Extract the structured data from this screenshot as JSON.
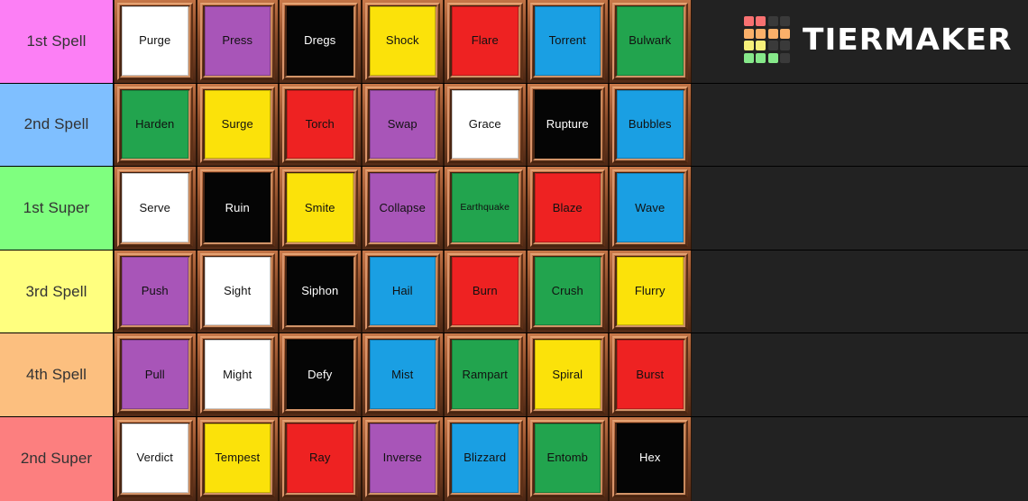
{
  "app": {
    "name": "TierMaker",
    "background_color": "#222222",
    "frame_color": "#a7613a"
  },
  "logo": {
    "wordmark": "TIERMAKER",
    "grid_colors": [
      [
        "#f87171",
        "#f87171",
        "#3a3a3a",
        "#3a3a3a"
      ],
      [
        "#fbb069",
        "#fbb069",
        "#fbb069",
        "#fbb069"
      ],
      [
        "#f7f07a",
        "#f7f07a",
        "#3a3a3a",
        "#3a3a3a"
      ],
      [
        "#86e88a",
        "#86e88a",
        "#86e88a",
        "#3a3a3a"
      ]
    ]
  },
  "palette": {
    "white": "#ffffff",
    "purple": "#a855b8",
    "black": "#050505",
    "yellow": "#fbe20a",
    "red": "#ee2222",
    "blue": "#1a9fe3",
    "green": "#22a martial"
  },
  "tiers": [
    {
      "label": "1st Spell",
      "color": "#fc7ff5",
      "cards": [
        {
          "label": "Purge",
          "bg": "#ffffff",
          "fg": "#111111"
        },
        {
          "label": "Press",
          "bg": "#a855b8",
          "fg": "#111111"
        },
        {
          "label": "Dregs",
          "bg": "#050505",
          "fg": "#ffffff"
        },
        {
          "label": "Shock",
          "bg": "#fbe20a",
          "fg": "#111111"
        },
        {
          "label": "Flare",
          "bg": "#ee2222",
          "fg": "#111111"
        },
        {
          "label": "Torrent",
          "bg": "#1a9fe3",
          "fg": "#111111"
        },
        {
          "label": "Bulwark",
          "bg": "#22a44e",
          "fg": "#111111"
        }
      ]
    },
    {
      "label": "2nd Spell",
      "color": "#7fbfff",
      "cards": [
        {
          "label": "Harden",
          "bg": "#22a44e",
          "fg": "#111111"
        },
        {
          "label": "Surge",
          "bg": "#fbe20a",
          "fg": "#111111"
        },
        {
          "label": "Torch",
          "bg": "#ee2222",
          "fg": "#111111"
        },
        {
          "label": "Swap",
          "bg": "#a855b8",
          "fg": "#111111"
        },
        {
          "label": "Grace",
          "bg": "#ffffff",
          "fg": "#111111"
        },
        {
          "label": "Rupture",
          "bg": "#050505",
          "fg": "#ffffff"
        },
        {
          "label": "Bubbles",
          "bg": "#1a9fe3",
          "fg": "#111111"
        }
      ]
    },
    {
      "label": "1st Super",
      "color": "#7fff7f",
      "cards": [
        {
          "label": "Serve",
          "bg": "#ffffff",
          "fg": "#111111"
        },
        {
          "label": "Ruin",
          "bg": "#050505",
          "fg": "#ffffff"
        },
        {
          "label": "Smite",
          "bg": "#fbe20a",
          "fg": "#111111"
        },
        {
          "label": "Collapse",
          "bg": "#a855b8",
          "fg": "#111111"
        },
        {
          "label": "Earthquake",
          "bg": "#22a44e",
          "fg": "#111111"
        },
        {
          "label": "Blaze",
          "bg": "#ee2222",
          "fg": "#111111"
        },
        {
          "label": "Wave",
          "bg": "#1a9fe3",
          "fg": "#111111"
        }
      ]
    },
    {
      "label": "3rd Spell",
      "color": "#ffff7f",
      "cards": [
        {
          "label": "Push",
          "bg": "#a855b8",
          "fg": "#111111"
        },
        {
          "label": "Sight",
          "bg": "#ffffff",
          "fg": "#111111"
        },
        {
          "label": "Siphon",
          "bg": "#050505",
          "fg": "#ffffff"
        },
        {
          "label": "Hail",
          "bg": "#1a9fe3",
          "fg": "#111111"
        },
        {
          "label": "Burn",
          "bg": "#ee2222",
          "fg": "#111111"
        },
        {
          "label": "Crush",
          "bg": "#22a44e",
          "fg": "#111111"
        },
        {
          "label": "Flurry",
          "bg": "#fbe20a",
          "fg": "#111111"
        }
      ]
    },
    {
      "label": "4th Spell",
      "color": "#fcbf7f",
      "cards": [
        {
          "label": "Pull",
          "bg": "#a855b8",
          "fg": "#111111"
        },
        {
          "label": "Might",
          "bg": "#ffffff",
          "fg": "#111111"
        },
        {
          "label": "Defy",
          "bg": "#050505",
          "fg": "#ffffff"
        },
        {
          "label": "Mist",
          "bg": "#1a9fe3",
          "fg": "#111111"
        },
        {
          "label": "Rampart",
          "bg": "#22a44e",
          "fg": "#111111"
        },
        {
          "label": "Spiral",
          "bg": "#fbe20a",
          "fg": "#111111"
        },
        {
          "label": "Burst",
          "bg": "#ee2222",
          "fg": "#111111"
        }
      ]
    },
    {
      "label": "2nd Super",
      "color": "#fc7f7f",
      "cards": [
        {
          "label": "Verdict",
          "bg": "#ffffff",
          "fg": "#111111"
        },
        {
          "label": "Tempest",
          "bg": "#fbe20a",
          "fg": "#111111"
        },
        {
          "label": "Ray",
          "bg": "#ee2222",
          "fg": "#111111"
        },
        {
          "label": "Inverse",
          "bg": "#a855b8",
          "fg": "#111111"
        },
        {
          "label": "Blizzard",
          "bg": "#1a9fe3",
          "fg": "#111111"
        },
        {
          "label": "Entomb",
          "bg": "#22a44e",
          "fg": "#111111"
        },
        {
          "label": "Hex",
          "bg": "#050505",
          "fg": "#ffffff"
        }
      ]
    }
  ]
}
